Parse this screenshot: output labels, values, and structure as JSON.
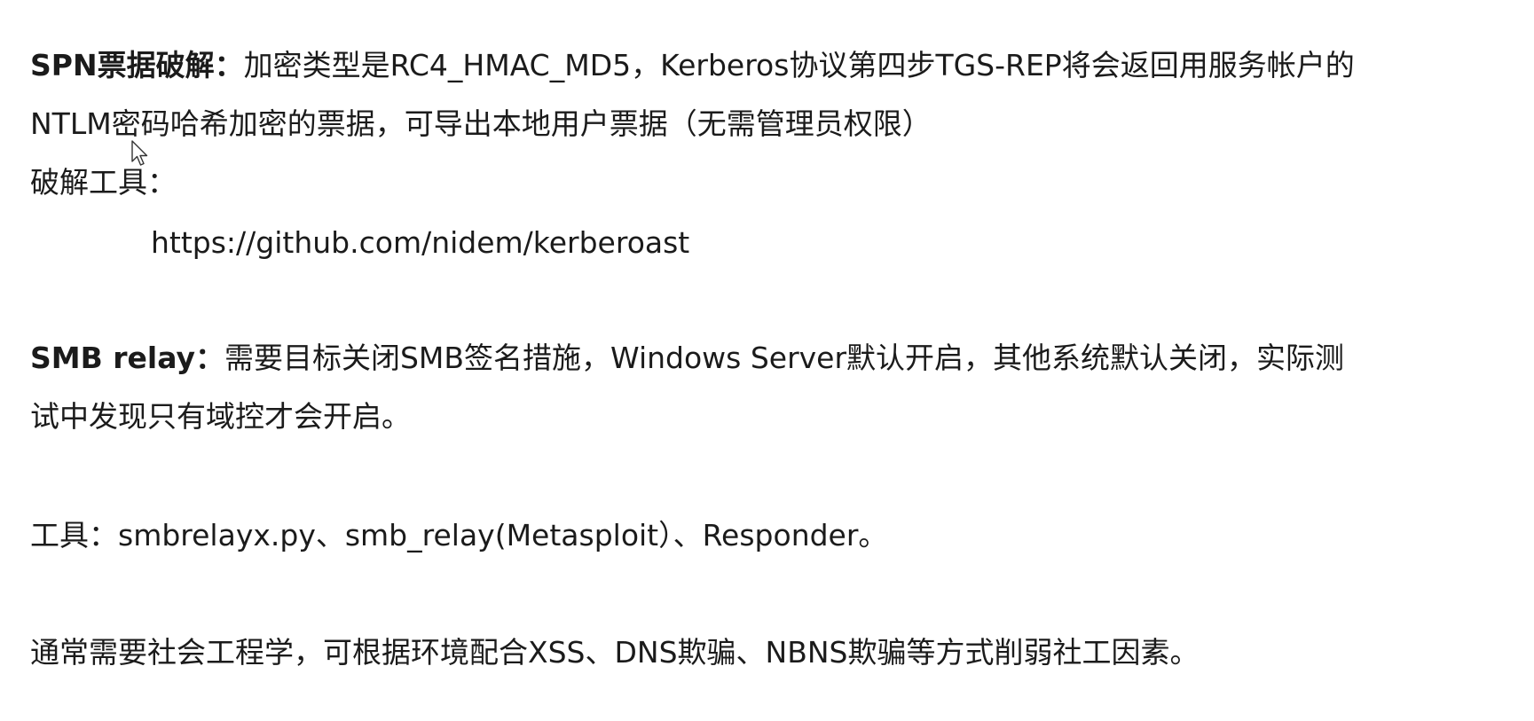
{
  "spn": {
    "heading": "SPN票据破解：",
    "line1": "加密类型是RC4_HMAC_MD5，Kerberos协议第四步TGS-REP将会返回用服务帐户的",
    "line2": "NTLM密码哈希加密的票据，可导出本地用户票据（无需管理员权限）",
    "tool_label": "破解工具：",
    "tool_url": "https://github.com/nidem/kerberoast"
  },
  "smb": {
    "heading": "SMB relay：",
    "line1": "需要目标关闭SMB签名措施，Windows Server默认开启，其他系统默认关闭，实际测",
    "line2": "试中发现只有域控才会开启。",
    "tools": "工具：smbrelayx.py、smb_relay(Metasploit）、Responder。",
    "note": "通常需要社会工程学，可根据环境配合XSS、DNS欺骗、NBNS欺骗等方式削弱社工因素。"
  },
  "icons": {
    "cursor": "mouse-pointer-icon"
  }
}
